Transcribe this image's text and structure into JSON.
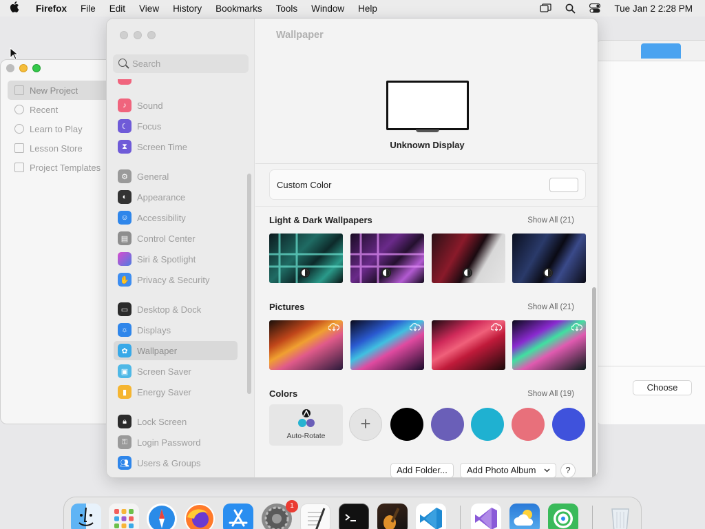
{
  "menubar": {
    "app": "Firefox",
    "items": [
      "File",
      "Edit",
      "View",
      "History",
      "Bookmarks",
      "Tools",
      "Window",
      "Help"
    ],
    "clock": "Tue Jan 2  2:28 PM",
    "icons": [
      "apple-logo-icon",
      "screen-mirroring-icon",
      "spotlight-search-icon",
      "control-center-icon"
    ]
  },
  "background_window": {
    "nav": [
      "New Project",
      "Recent",
      "Learn to Play",
      "Lesson Store",
      "Project Templates"
    ],
    "choose_label": "Choose"
  },
  "settings": {
    "search_placeholder": "Search",
    "sidebar": [
      {
        "label": "Sound",
        "icon": "sound-icon",
        "color": "#f0647d"
      },
      {
        "label": "Focus",
        "icon": "focus-moon-icon",
        "color": "#6f5bd8"
      },
      {
        "label": "Screen Time",
        "icon": "hourglass-icon",
        "color": "#6f5bd8"
      },
      {
        "label": "General",
        "icon": "gear-icon",
        "color": "#9a9a9a"
      },
      {
        "label": "Appearance",
        "icon": "appearance-icon",
        "color": "#333333"
      },
      {
        "label": "Accessibility",
        "icon": "accessibility-icon",
        "color": "#2f86ea"
      },
      {
        "label": "Control Center",
        "icon": "control-center-icon",
        "color": "#8e8e8e"
      },
      {
        "label": "Siri & Spotlight",
        "icon": "siri-icon",
        "color": "#c34bd1"
      },
      {
        "label": "Privacy & Security",
        "icon": "hand-icon",
        "color": "#3d8df0"
      },
      {
        "label": "Desktop & Dock",
        "icon": "dock-icon",
        "color": "#2b2b2b"
      },
      {
        "label": "Displays",
        "icon": "displays-icon",
        "color": "#2f86ea"
      },
      {
        "label": "Wallpaper",
        "icon": "wallpaper-icon",
        "color": "#38a9e8"
      },
      {
        "label": "Screen Saver",
        "icon": "screen-saver-icon",
        "color": "#4fb8e6"
      },
      {
        "label": "Energy Saver",
        "icon": "battery-icon",
        "color": "#f5b531"
      },
      {
        "label": "Lock Screen",
        "icon": "lock-icon",
        "color": "#2b2b2b"
      },
      {
        "label": "Login Password",
        "icon": "key-icon",
        "color": "#9a9a9a"
      },
      {
        "label": "Users & Groups",
        "icon": "users-icon",
        "color": "#2f86ea"
      }
    ],
    "selected": "Wallpaper",
    "pane": {
      "title": "Wallpaper",
      "display_name": "Unknown Display",
      "custom_color_label": "Custom Color",
      "sections": [
        {
          "title": "Light & Dark Wallpapers",
          "show_all": "Show All (21)"
        },
        {
          "title": "Pictures",
          "show_all": "Show All (21)"
        },
        {
          "title": "Colors",
          "show_all": "Show All (19)"
        }
      ],
      "auto_rotate_label": "Auto-Rotate",
      "add_color_symbol": "+",
      "colors": [
        "#000000",
        "#6a5fb8",
        "#1fb1d1",
        "#e8707b",
        "#3f52dc"
      ],
      "add_folder_label": "Add Folder...",
      "add_album_label": "Add Photo Album",
      "help_label": "?"
    }
  },
  "dock": {
    "apps": [
      "Finder",
      "Launchpad",
      "Safari",
      "Firefox",
      "App Store",
      "System Settings",
      "TextEdit",
      "Terminal",
      "GarageBand",
      "Visual Studio Code",
      "Visual Studio",
      "Weather",
      "Find My",
      "Trash"
    ],
    "settings_badge": "1"
  }
}
